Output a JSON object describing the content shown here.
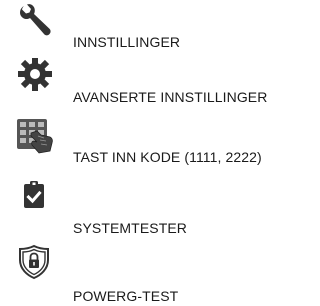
{
  "menu": {
    "items": [
      {
        "label": "INNSTILLINGER",
        "icon": "wrench-icon"
      },
      {
        "label": "AVANSERTE INNSTILLINGER",
        "icon": "gear-icon"
      },
      {
        "label": "TAST INN KODE (1111, 2222)",
        "icon": "keypad-hand-icon"
      },
      {
        "label": "SYSTEMTESTER",
        "icon": "clipboard-check-icon"
      },
      {
        "label": "POWERG-TEST",
        "icon": "shield-lock-icon"
      }
    ]
  },
  "colors": {
    "icon": "#333333",
    "text": "#1a1a1a",
    "background": "#ffffff"
  }
}
